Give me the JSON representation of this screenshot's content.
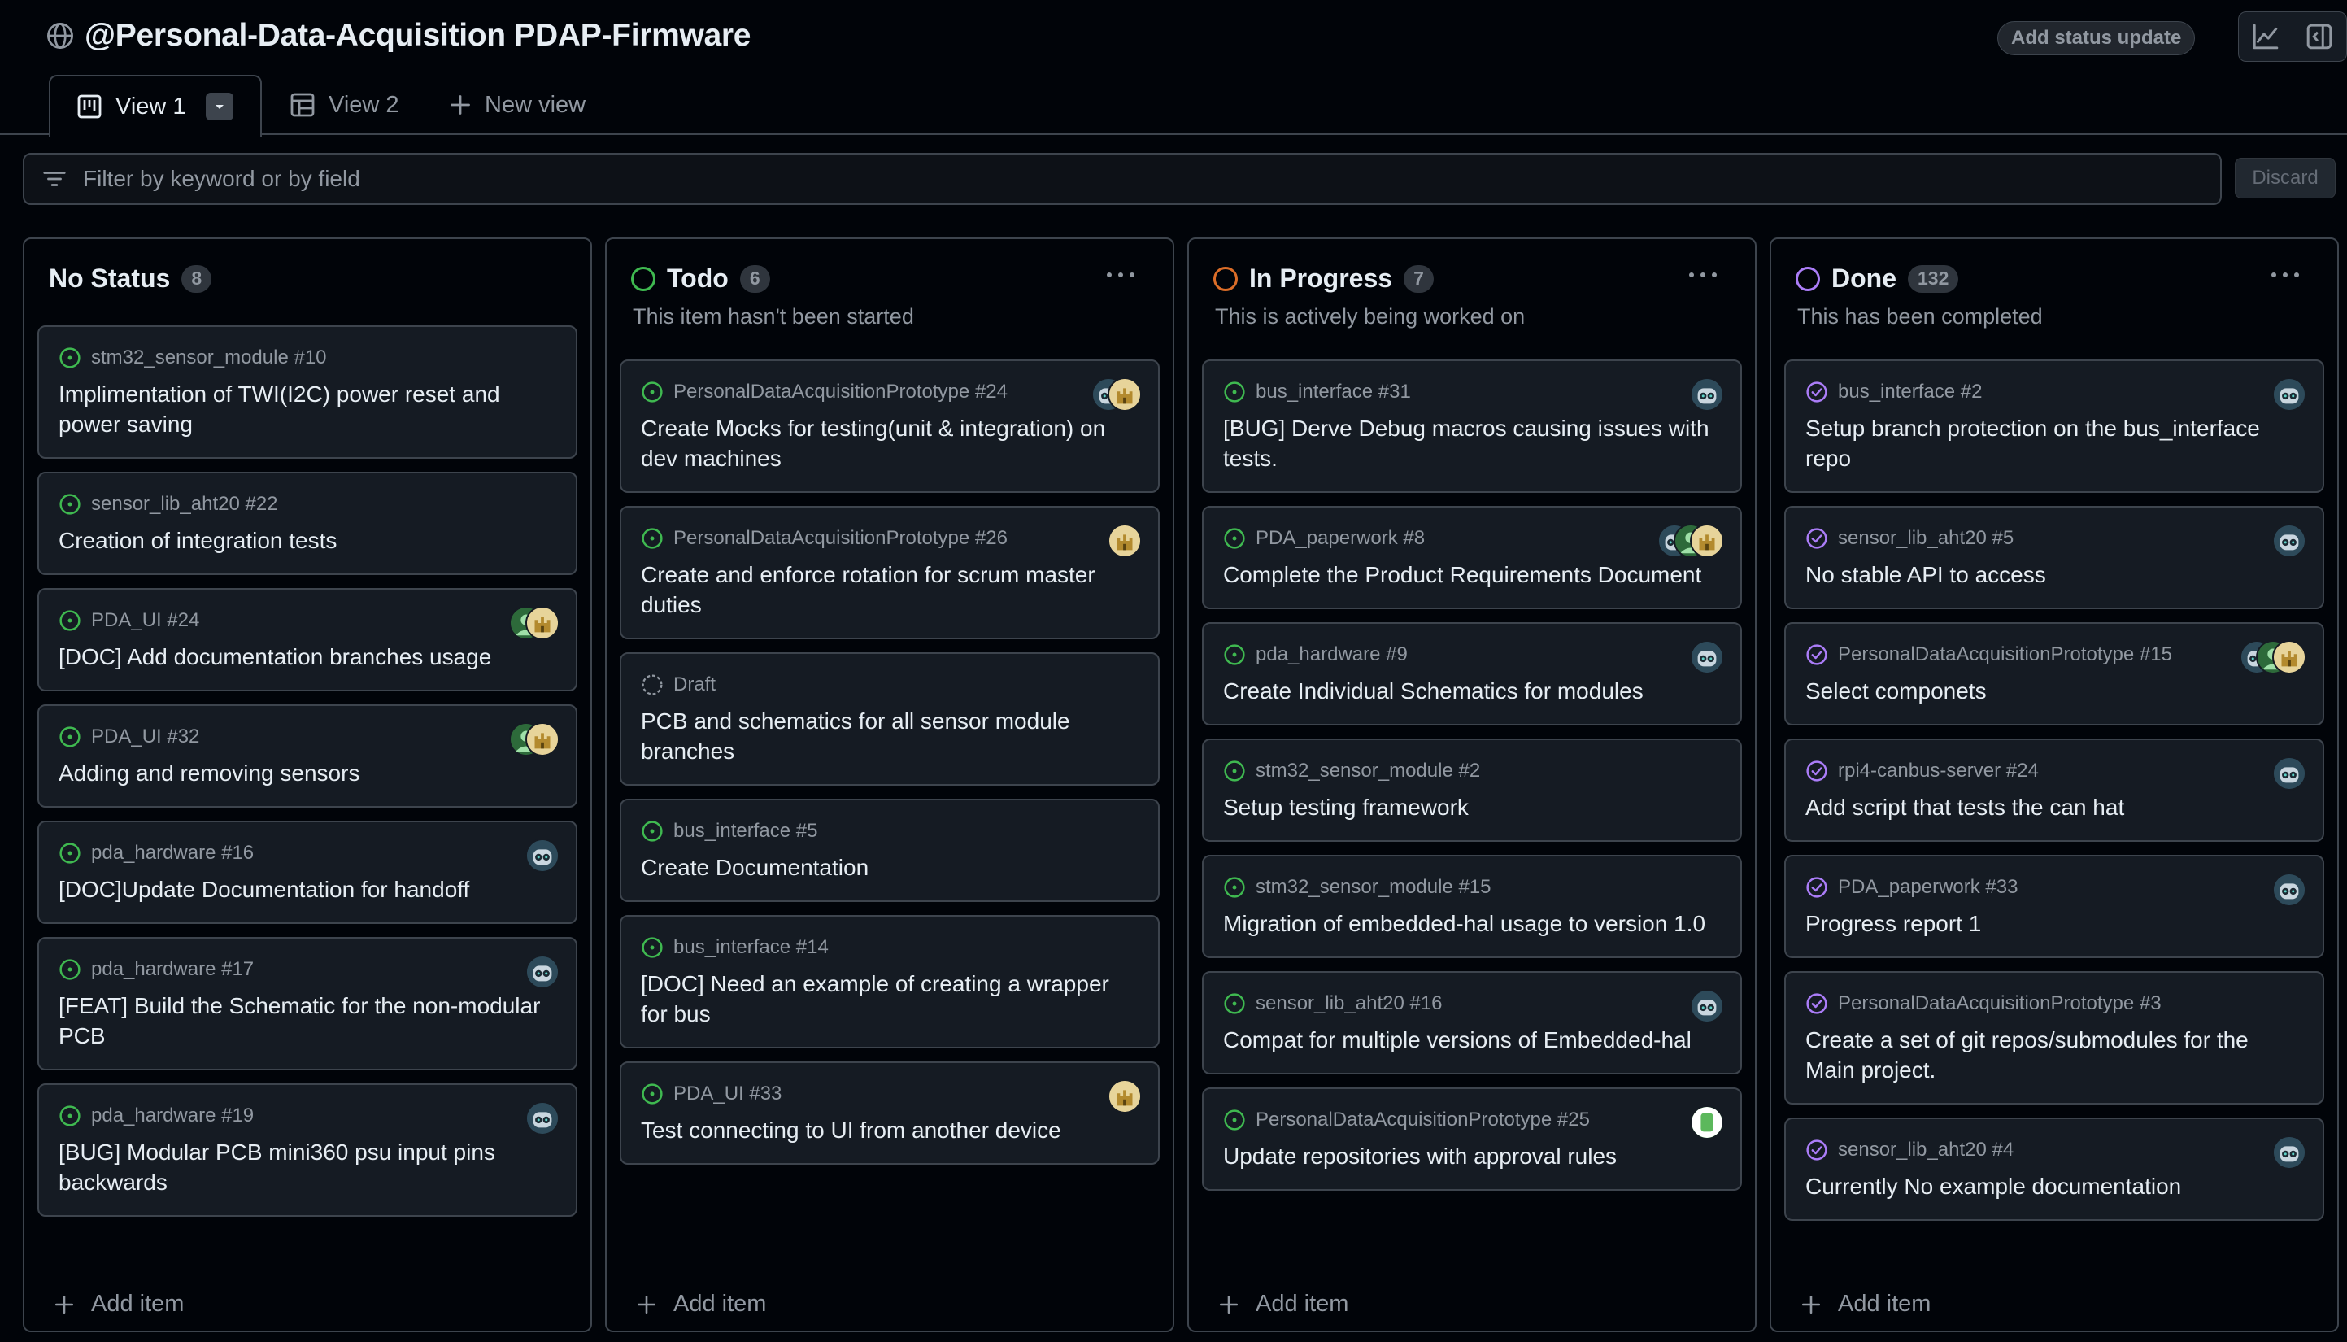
{
  "header": {
    "title": "@Personal-Data-Acquisition PDAP-Firmware",
    "status_button": "Add status update",
    "icons": [
      "globe-icon",
      "graph-icon",
      "sidebar-icon"
    ]
  },
  "tabs": [
    {
      "label": "View 1",
      "icon": "board-icon",
      "active": true
    },
    {
      "label": "View 2",
      "icon": "table-icon",
      "active": false
    },
    {
      "label": "New view",
      "icon": "plus-icon",
      "active": false
    }
  ],
  "filter": {
    "placeholder": "Filter by keyword or by field",
    "discard_label": "Discard"
  },
  "add_item_label": "Add item",
  "colors": {
    "open_issue": "#3fb950",
    "closed_issue": "#ab7df8",
    "todo": "#3fb950",
    "in_progress": "#db6d28",
    "done": "#ab7df8"
  },
  "columns": [
    {
      "title": "No Status",
      "count": "8",
      "description": "",
      "cards": [
        {
          "repo": "stm32_sensor_module #10",
          "title": "Implimentation of TWI(I2C) power reset and power saving",
          "state": "open",
          "avatars": []
        },
        {
          "repo": "sensor_lib_aht20 #22",
          "title": "Creation of integration tests",
          "state": "open",
          "avatars": []
        },
        {
          "repo": "PDA_UI #24",
          "title": "[DOC] Add documentation branches usage",
          "state": "open",
          "avatars": [
            "green",
            "castle"
          ]
        },
        {
          "repo": "PDA_UI #32",
          "title": "Adding and removing sensors",
          "state": "open",
          "avatars": [
            "green",
            "castle"
          ]
        },
        {
          "repo": "pda_hardware #16",
          "title": "[DOC]Update Documentation for handoff",
          "state": "open",
          "avatars": [
            "robot"
          ]
        },
        {
          "repo": "pda_hardware #17",
          "title": "[FEAT] Build the Schematic for the non-modular PCB",
          "state": "open",
          "avatars": [
            "robot"
          ]
        },
        {
          "repo": "pda_hardware #19",
          "title": "[BUG] Modular PCB mini360 psu input pins backwards",
          "state": "open",
          "avatars": [
            "robot"
          ]
        }
      ]
    },
    {
      "title": "Todo",
      "count": "6",
      "description": "This item hasn't been started",
      "cards": [
        {
          "repo": "PersonalDataAcquisitionPrototype #24",
          "title": "Create Mocks for testing(unit & integration) on dev machines",
          "state": "open",
          "avatars": [
            "robot",
            "castle"
          ]
        },
        {
          "repo": "PersonalDataAcquisitionPrototype #26",
          "title": "Create and enforce rotation for scrum master duties",
          "state": "open",
          "avatars": [
            "castle"
          ]
        },
        {
          "repo": "Draft",
          "title": "PCB and schematics for all sensor module branches",
          "state": "draft",
          "avatars": []
        },
        {
          "repo": "bus_interface #5",
          "title": "Create Documentation",
          "state": "open",
          "avatars": []
        },
        {
          "repo": "bus_interface #14",
          "title": "[DOC] Need an example of creating a wrapper for bus",
          "state": "open",
          "avatars": []
        },
        {
          "repo": "PDA_UI #33",
          "title": "Test connecting to UI from another device",
          "state": "open",
          "avatars": [
            "castle"
          ]
        }
      ]
    },
    {
      "title": "In Progress",
      "count": "7",
      "description": "This is actively being worked on",
      "cards": [
        {
          "repo": "bus_interface #31",
          "title": "[BUG] Derve Debug macros causing issues with tests.",
          "state": "open",
          "avatars": [
            "robot"
          ]
        },
        {
          "repo": "PDA_paperwork #8",
          "title": "Complete the Product Requirements Document",
          "state": "open",
          "avatars": [
            "robot",
            "green",
            "castle"
          ]
        },
        {
          "repo": "pda_hardware #9",
          "title": "Create Individual Schematics for modules",
          "state": "open",
          "avatars": [
            "robot"
          ]
        },
        {
          "repo": "stm32_sensor_module #2",
          "title": "Setup testing framework",
          "state": "open",
          "avatars": []
        },
        {
          "repo": "stm32_sensor_module #15",
          "title": "Migration of embedded-hal usage to version 1.0",
          "state": "open",
          "avatars": []
        },
        {
          "repo": "sensor_lib_aht20 #16",
          "title": "Compat for multiple versions of Embedded-hal",
          "state": "open",
          "avatars": [
            "robot"
          ]
        },
        {
          "repo": "PersonalDataAcquisitionPrototype #25",
          "title": "Update repositories with approval rules",
          "state": "open",
          "avatars": [
            "mint"
          ]
        }
      ]
    },
    {
      "title": "Done",
      "count": "132",
      "description": "This has been completed",
      "cards": [
        {
          "repo": "bus_interface #2",
          "title": "Setup branch protection on the bus_interface repo",
          "state": "closed",
          "avatars": [
            "robot"
          ]
        },
        {
          "repo": "sensor_lib_aht20 #5",
          "title": "No stable API to access",
          "state": "closed",
          "avatars": [
            "robot"
          ]
        },
        {
          "repo": "PersonalDataAcquisitionPrototype #15",
          "title": "Select componets",
          "state": "closed",
          "avatars": [
            "robot",
            "green",
            "castle"
          ]
        },
        {
          "repo": "rpi4-canbus-server #24",
          "title": "Add script that tests the can hat",
          "state": "closed",
          "avatars": [
            "robot"
          ]
        },
        {
          "repo": "PDA_paperwork #33",
          "title": "Progress report 1",
          "state": "closed",
          "avatars": [
            "robot"
          ]
        },
        {
          "repo": "PersonalDataAcquisitionPrototype #3",
          "title": "Create a set of git repos/submodules for the Main project.",
          "state": "closed",
          "avatars": []
        },
        {
          "repo": "sensor_lib_aht20 #4",
          "title": "Currently No example documentation",
          "state": "closed",
          "avatars": [
            "robot"
          ]
        }
      ]
    }
  ]
}
